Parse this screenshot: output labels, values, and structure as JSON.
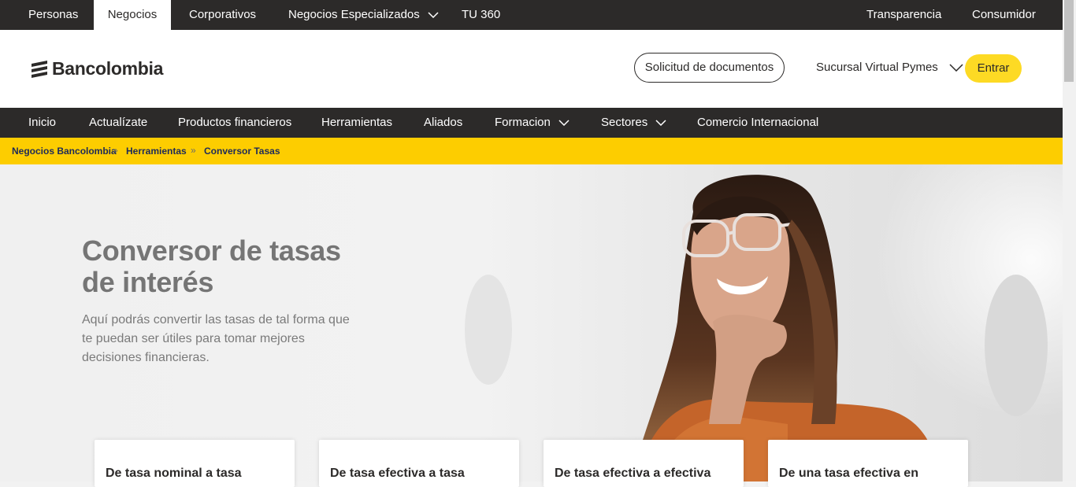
{
  "topbar": {
    "items": [
      {
        "label": "Personas"
      },
      {
        "label": "Negocios"
      },
      {
        "label": "Corporativos"
      },
      {
        "label": "Negocios Especializados"
      },
      {
        "label": "TU 360"
      }
    ],
    "active": "Negocios",
    "right_items": [
      {
        "label": "Transparencia"
      },
      {
        "label": "Consumidor"
      }
    ]
  },
  "header": {
    "logo_text": "Bancolombia",
    "docs_button": "Solicitud de documentos",
    "sucursal": "Sucursal Virtual Pymes",
    "login_button": "Entrar"
  },
  "mainnav": {
    "items": [
      {
        "label": "Inicio"
      },
      {
        "label": "Actualízate"
      },
      {
        "label": "Productos financieros"
      },
      {
        "label": "Herramientas"
      },
      {
        "label": "Aliados"
      },
      {
        "label": "Formacion"
      },
      {
        "label": "Sectores"
      },
      {
        "label": "Comercio Internacional"
      }
    ]
  },
  "breadcrumb": {
    "items": [
      {
        "label": "Negocios Bancolombia"
      },
      {
        "label": "Herramientas"
      },
      {
        "label": "Conversor Tasas"
      }
    ],
    "separator": "»"
  },
  "hero": {
    "title": "Conversor de tasas de interés",
    "description": "Aquí podrás convertir las tasas de tal forma que te puedan ser útiles para tomar mejores decisiones financieras."
  },
  "cards": [
    {
      "title": "De tasa nominal a tasa"
    },
    {
      "title": "De tasa efectiva a tasa"
    },
    {
      "title": "De tasa efectiva a efectiva"
    },
    {
      "title": "De una tasa efectiva en"
    }
  ],
  "colors": {
    "dark": "#2c2a29",
    "brand_yellow": "#fdda24",
    "breadcrumb_bg": "#fdcd00",
    "breadcrumb_text": "#1d2a5a"
  }
}
